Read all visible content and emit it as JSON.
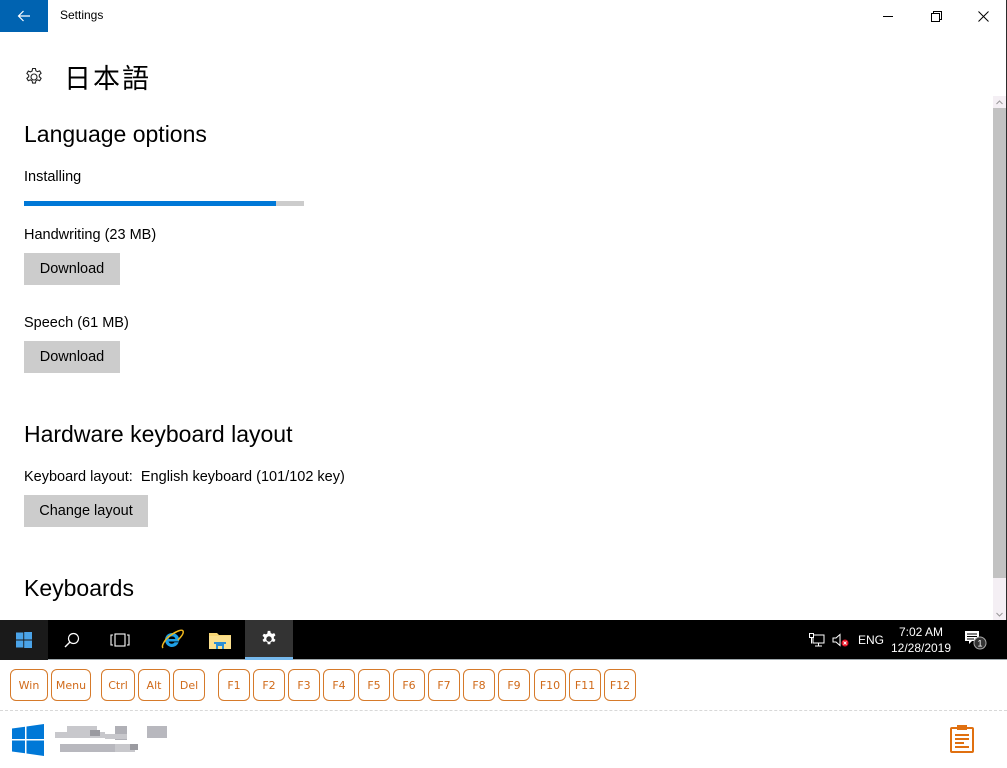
{
  "window": {
    "app_title": "Settings",
    "page_title": "日本語",
    "controls": {
      "back": "back-arrow-icon",
      "minimize": "minimize-icon",
      "maximize": "restore-icon",
      "close": "close-icon"
    }
  },
  "language_options": {
    "heading": "Language options",
    "status_label": "Installing",
    "progress_percent": 90,
    "handwriting": {
      "label": "Handwriting (23 MB)",
      "button": "Download"
    },
    "speech": {
      "label": "Speech (61 MB)",
      "button": "Download"
    }
  },
  "hardware_keyboard": {
    "heading": "Hardware keyboard layout",
    "layout_label": "Keyboard layout:",
    "layout_value": "English keyboard (101/102 key)",
    "button": "Change layout"
  },
  "keyboards": {
    "heading": "Keyboards"
  },
  "taskbar": {
    "pinned": [
      "start",
      "search",
      "task-view",
      "internet-explorer",
      "file-explorer",
      "settings"
    ],
    "active": "settings",
    "tray": {
      "language": "ENG",
      "time": "7:02 AM",
      "date": "12/28/2019",
      "notification_count": "1"
    }
  },
  "remote_keys": {
    "keys": [
      "Win",
      "Menu",
      "Ctrl",
      "Alt",
      "Del",
      "F1",
      "F2",
      "F3",
      "F4",
      "F5",
      "F6",
      "F7",
      "F8",
      "F9",
      "F10",
      "F11",
      "F12"
    ]
  },
  "colors": {
    "accent": "#0078d7",
    "back_button": "#0063b1",
    "remote_key": "#d67a2a",
    "taskbar_active_indicator": "#76b9ed"
  }
}
